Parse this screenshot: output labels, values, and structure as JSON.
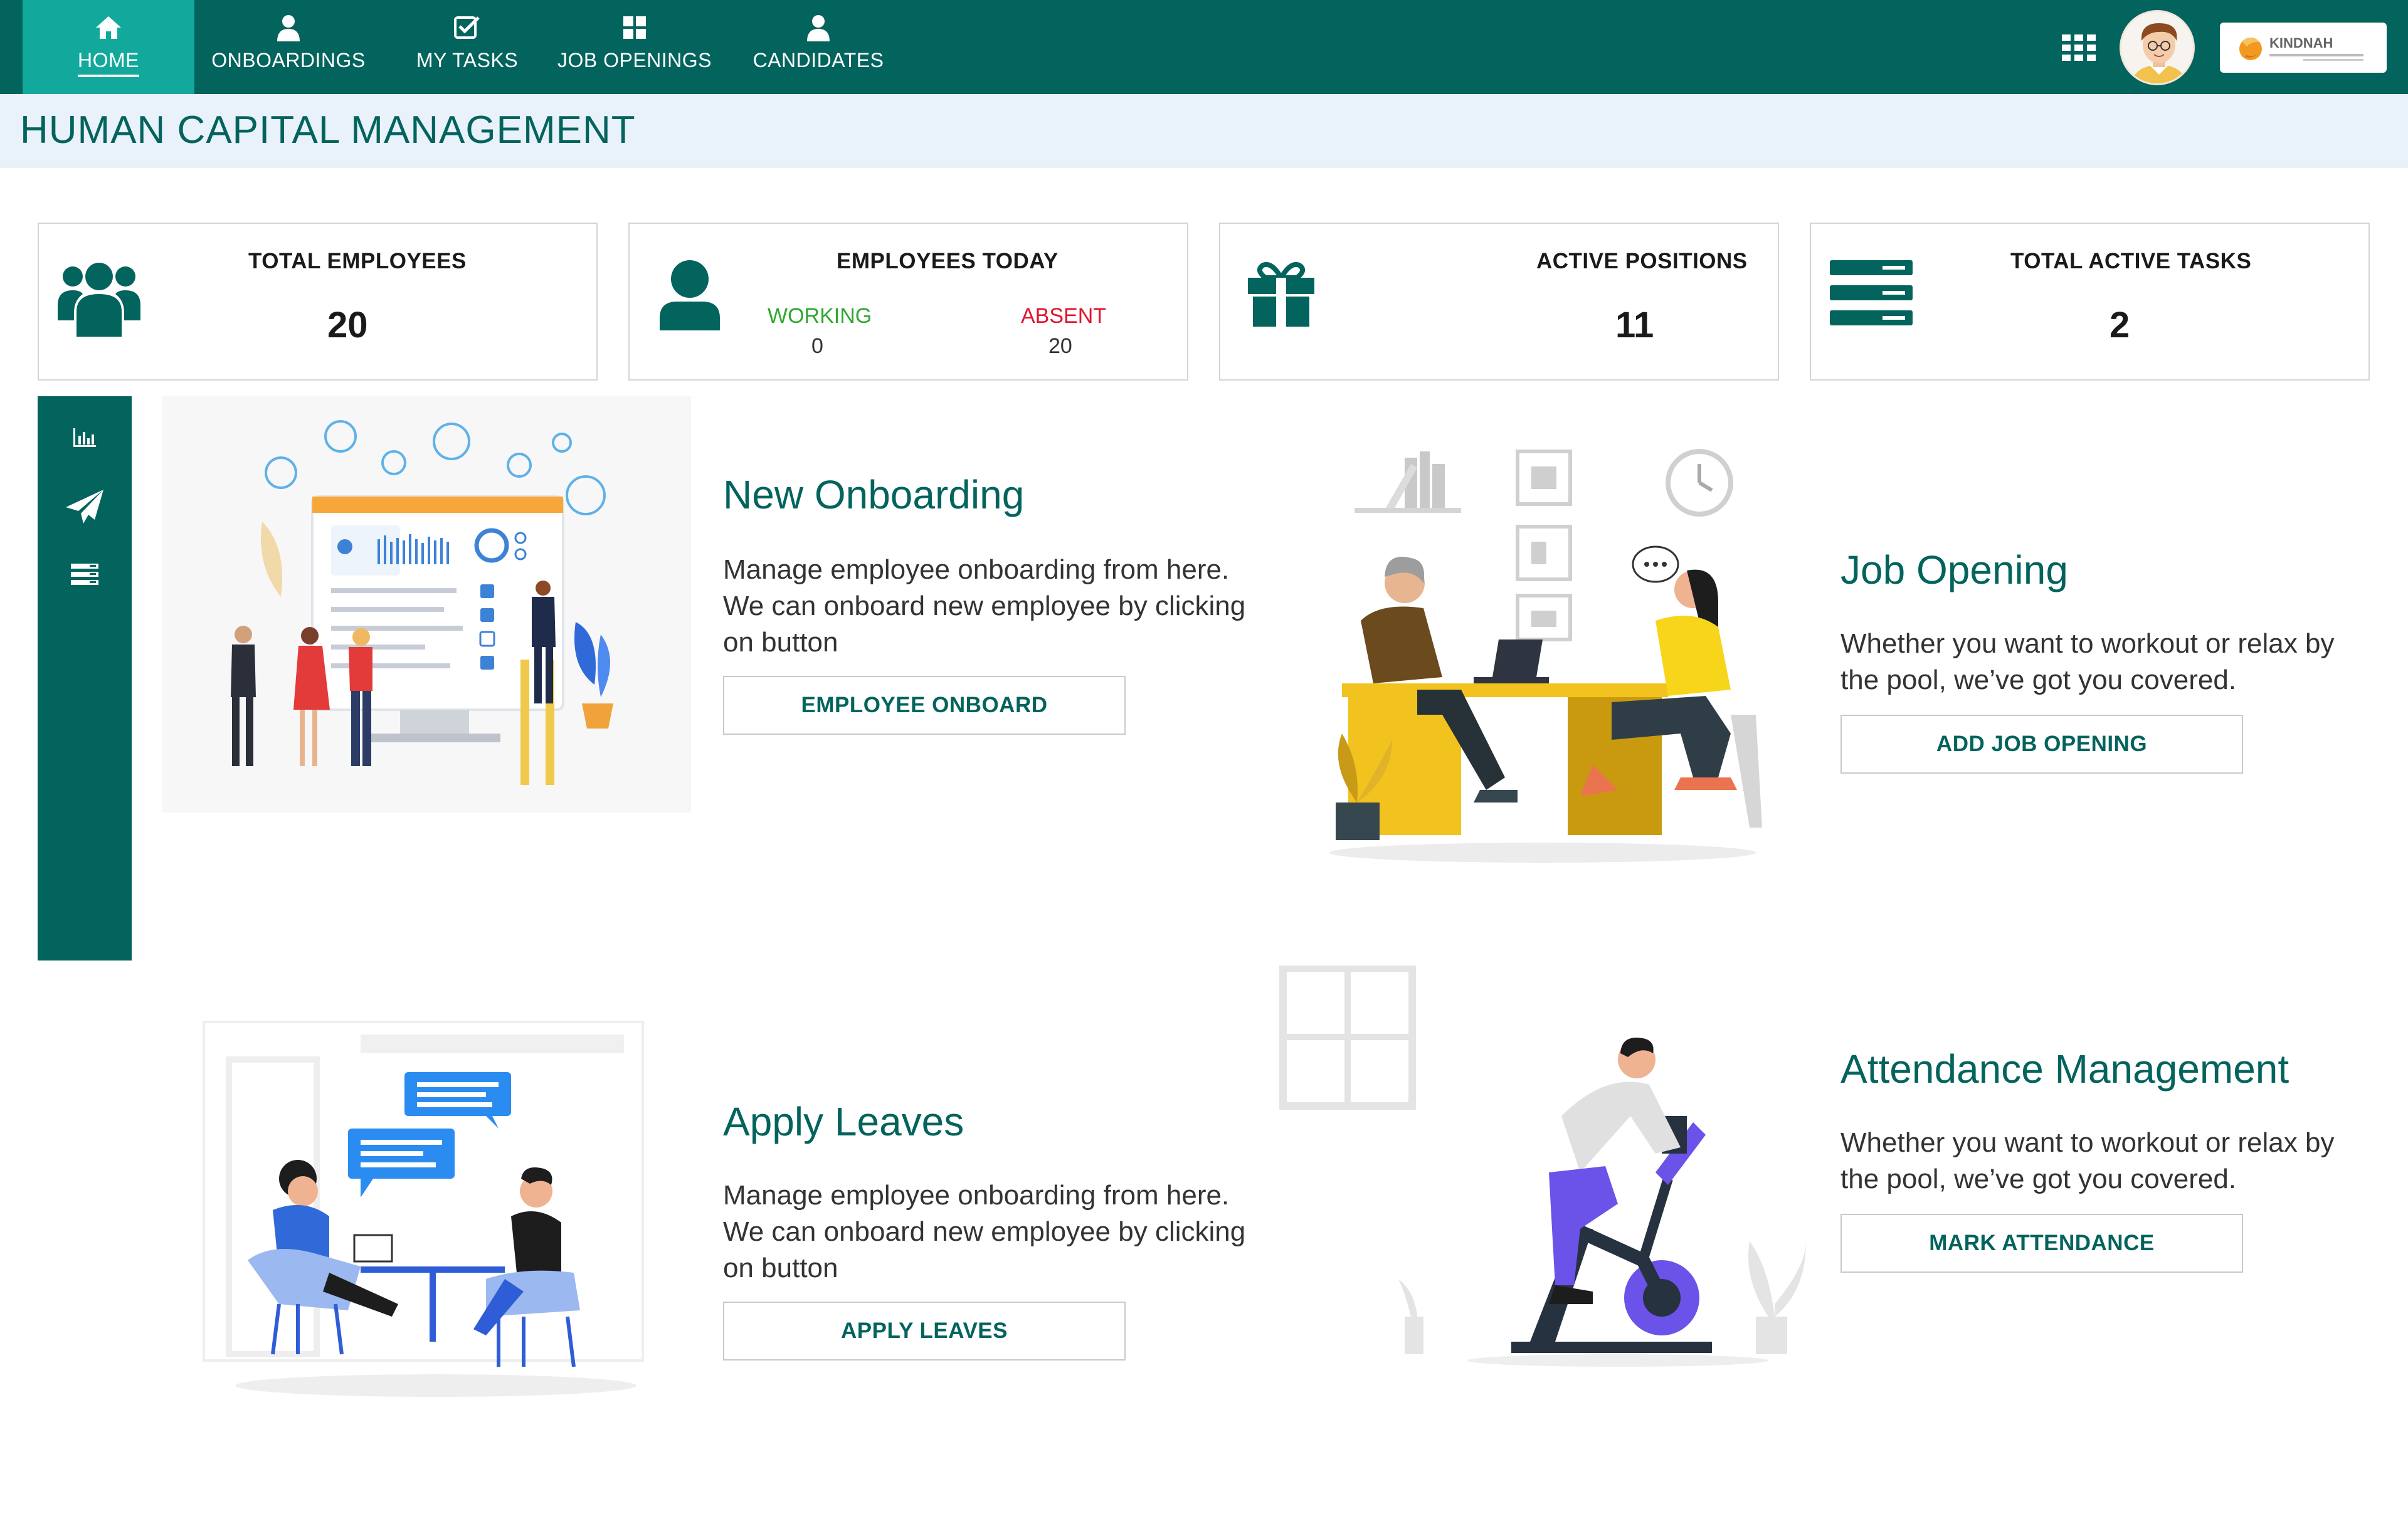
{
  "nav": {
    "items": [
      {
        "label": "HOME",
        "icon": "home-icon",
        "active": true
      },
      {
        "label": "ONBOARDINGS",
        "icon": "user-icon",
        "active": false
      },
      {
        "label": "MY TASKS",
        "icon": "check-square-icon",
        "active": false
      },
      {
        "label": "JOB OPENINGS",
        "icon": "grid-icon",
        "active": false
      },
      {
        "label": "CANDIDATES",
        "icon": "user-icon",
        "active": false
      }
    ],
    "apps_icon": "apps-grid-icon",
    "logo_text": "KINDNAH"
  },
  "page": {
    "title": "HUMAN CAPITAL MANAGEMENT"
  },
  "stats": {
    "total_employees": {
      "label": "TOTAL EMPLOYEES",
      "value": "20"
    },
    "employees_today": {
      "label": "EMPLOYEES TODAY",
      "working_label": "WORKING",
      "working_value": "0",
      "absent_label": "ABSENT",
      "absent_value": "20"
    },
    "active_positions": {
      "label": "ACTIVE POSITIONS",
      "value": "11"
    },
    "total_active_tasks": {
      "label": "TOTAL ACTIVE TASKS",
      "value": "2"
    }
  },
  "rail": {
    "items": [
      "bar-chart-icon",
      "paper-plane-icon",
      "list-icon"
    ]
  },
  "features": {
    "onboarding": {
      "title": "New Onboarding",
      "desc": "Manage employee onboarding from here. We can onboard new employee by clicking on button",
      "button": "EMPLOYEE ONBOARD"
    },
    "job_opening": {
      "title": "Job Opening",
      "desc": "Whether you want to workout or relax by the pool, we’ve got you covered.",
      "button": "ADD JOB OPENING"
    },
    "leaves": {
      "title": "Apply Leaves",
      "desc": "Manage employee onboarding from here. We can onboard new employee by clicking on button",
      "button": "APPLY LEAVES"
    },
    "attendance": {
      "title": "Attendance Management",
      "desc": "Whether you want to workout or relax by the pool, we’ve got you covered.",
      "button": "MARK ATTENDANCE"
    }
  },
  "colors": {
    "primary": "#03635d",
    "active_tab": "#12a99c",
    "title_bar": "#e9f1fb",
    "working": "#2fa82f",
    "absent": "#e0142c"
  }
}
